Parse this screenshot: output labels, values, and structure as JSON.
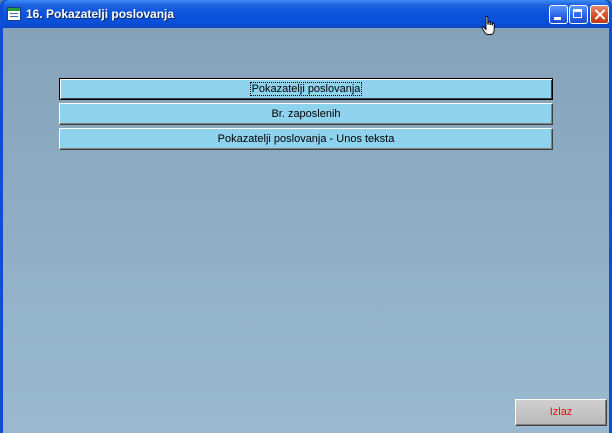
{
  "window": {
    "title": "16. Pokazatelji poslovanja"
  },
  "menu": {
    "items": [
      {
        "label": "Pokazatelji poslovanja",
        "focused": true
      },
      {
        "label": "Br. zaposlenih",
        "focused": false
      },
      {
        "label": "Pokazatelji poslovanja - Unos teksta",
        "focused": false
      }
    ]
  },
  "footer": {
    "exit_label": "Izlaz",
    "exit_color": "#e01010"
  },
  "icons": {
    "app": "form-icon",
    "minimize": "minimize-icon",
    "maximize": "maximize-icon",
    "close": "close-icon",
    "pointer": "hand-pointer-icon"
  },
  "colors": {
    "titlebar": "#0a4fd6",
    "menu_button": "#8fd2ee",
    "client_background": "#8dacc3"
  }
}
